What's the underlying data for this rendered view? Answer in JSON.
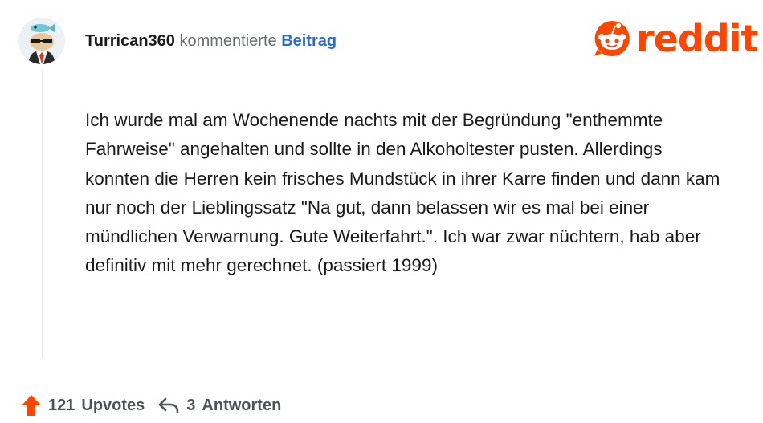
{
  "comment": {
    "username": "Turrican360",
    "action": "kommentierte",
    "post_link": "Beitrag",
    "text": "Ich wurde mal am Wochenende nachts mit der Begründung \"enthemmte Fahrweise\" angehalten und sollte in den Alkoholtester pusten. Allerdings konnten die Herren kein frisches Mundstück in ihrer Karre finden und dann kam nur noch der Lieblingssatz \"Na gut, dann belassen wir es mal bei einer mündlichen Verwarnung. Gute Weiterfahrt.\". Ich war zwar nüchtern, hab aber definitiv mit mehr gerechnet. (passiert 1999)"
  },
  "brand": {
    "logo_text": "reddit",
    "color": "#ff4500"
  },
  "footer": {
    "upvotes_count": "121",
    "upvotes_label": "Upvotes",
    "replies_count": "3",
    "replies_label": "Antworten"
  },
  "icons": {
    "avatar": "avatar-snoo-icon",
    "logo": "reddit-snoo-icon",
    "upvote": "upvote-arrow-icon",
    "reply": "reply-arrow-icon"
  }
}
